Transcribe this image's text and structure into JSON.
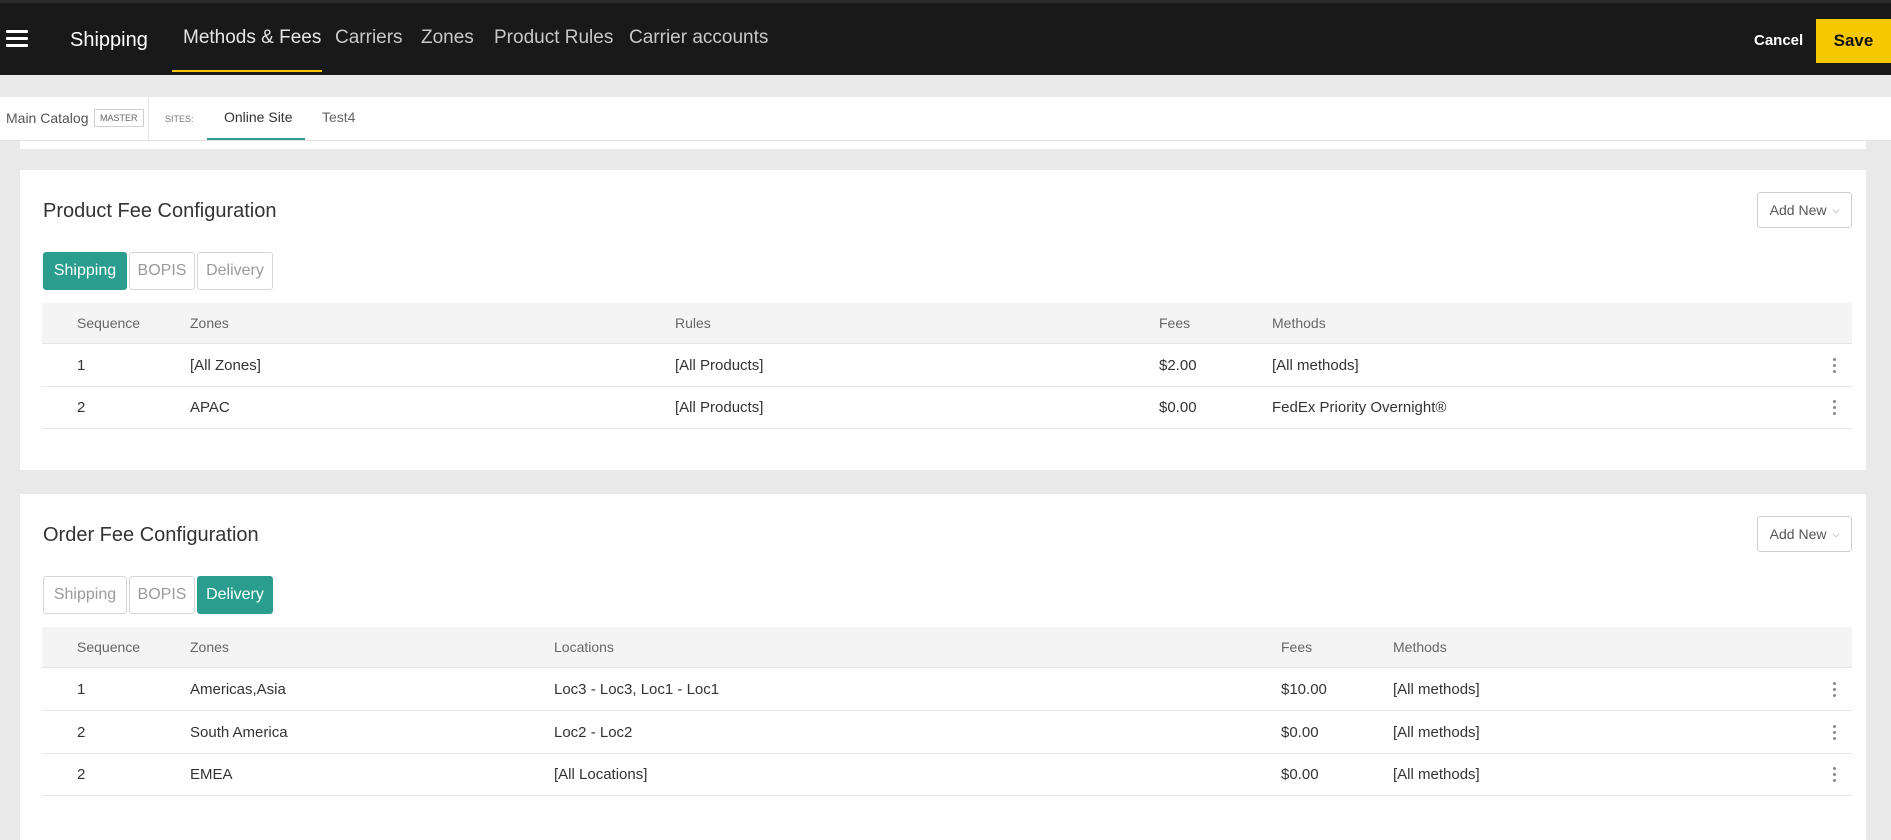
{
  "header": {
    "app_title": "Shipping",
    "tabs": [
      {
        "label": "Methods & Fees",
        "active": true
      },
      {
        "label": "Carriers"
      },
      {
        "label": "Zones"
      },
      {
        "label": "Product Rules"
      },
      {
        "label": "Carrier accounts"
      }
    ],
    "cancel_label": "Cancel",
    "save_label": "Save"
  },
  "sitebar": {
    "catalog": "Main Catalog",
    "catalog_badge": "MASTER",
    "sites_label": "SITES:",
    "sites": [
      {
        "label": "Online Site",
        "active": true
      },
      {
        "label": "Test4"
      }
    ]
  },
  "product_fee": {
    "title": "Product Fee Configuration",
    "add_new_label": "Add New",
    "segments": [
      {
        "label": "Shipping",
        "active": true
      },
      {
        "label": "BOPIS"
      },
      {
        "label": "Delivery"
      }
    ],
    "columns": {
      "sequence": "Sequence",
      "zones": "Zones",
      "rules": "Rules",
      "fees": "Fees",
      "methods": "Methods"
    },
    "rows": [
      {
        "sequence": "1",
        "zones": "[All Zones]",
        "rules": "[All Products]",
        "fees": "$2.00",
        "methods": "[All methods]"
      },
      {
        "sequence": "2",
        "zones": "APAC",
        "rules": "[All Products]",
        "fees": "$0.00",
        "methods": "FedEx Priority Overnight®"
      }
    ]
  },
  "order_fee": {
    "title": "Order Fee Configuration",
    "add_new_label": "Add New",
    "segments": [
      {
        "label": "Shipping"
      },
      {
        "label": "BOPIS"
      },
      {
        "label": "Delivery",
        "active": true
      }
    ],
    "columns": {
      "sequence": "Sequence",
      "zones": "Zones",
      "locations": "Locations",
      "fees": "Fees",
      "methods": "Methods"
    },
    "rows": [
      {
        "sequence": "1",
        "zones": "Americas,Asia",
        "locations": "Loc3 - Loc3, Loc1 - Loc1",
        "fees": "$10.00",
        "methods": "[All methods]"
      },
      {
        "sequence": "2",
        "zones": "South America",
        "locations": "Loc2 - Loc2",
        "fees": "$0.00",
        "methods": "[All methods]"
      },
      {
        "sequence": "2",
        "zones": "EMEA",
        "locations": "[All Locations]",
        "fees": "$0.00",
        "methods": "[All methods]"
      }
    ]
  },
  "colors": {
    "accent": "#2a9d8f",
    "save": "#f5c800",
    "topbar": "#191919",
    "nav_underline": "#f4c400"
  }
}
